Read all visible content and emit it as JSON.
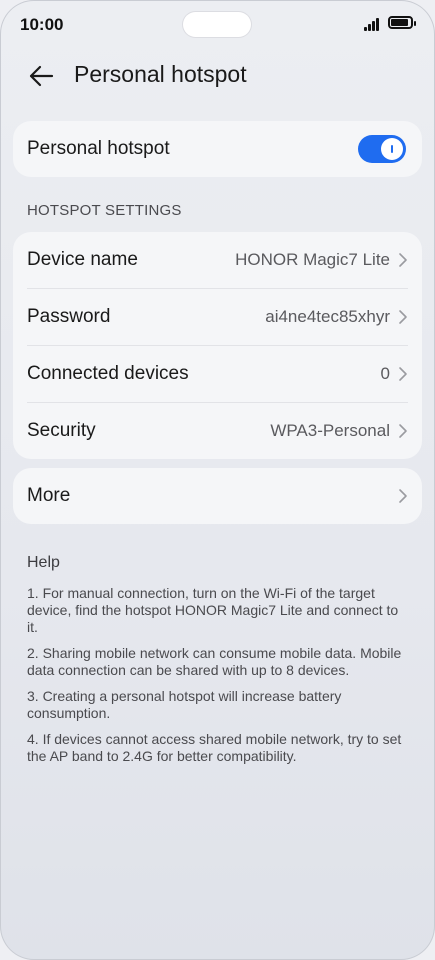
{
  "status_bar": {
    "time": "10:00"
  },
  "header": {
    "title": "Personal hotspot"
  },
  "hotspot_toggle": {
    "label": "Personal hotspot",
    "state": "on",
    "accent": "#1f6cf0"
  },
  "settings": {
    "section_title": "HOTSPOT SETTINGS",
    "items": [
      {
        "label": "Device name",
        "value": "HONOR Magic7 Lite"
      },
      {
        "label": "Password",
        "value": "ai4ne4tec85xhyr"
      },
      {
        "label": "Connected devices",
        "value": "0"
      },
      {
        "label": "Security",
        "value": "WPA3-Personal"
      }
    ]
  },
  "more": {
    "label": "More"
  },
  "help": {
    "title": "Help",
    "items": [
      "1. For manual connection, turn on the Wi-Fi of the target device, find the hotspot HONOR Magic7 Lite and connect to it.",
      "2. Sharing mobile network can consume mobile data. Mobile data connection can be shared with up to 8 devices.",
      "3. Creating a personal hotspot will increase battery consumption.",
      "4. If devices cannot access shared mobile network, try to set the AP band to 2.4G for better compatibility."
    ]
  }
}
